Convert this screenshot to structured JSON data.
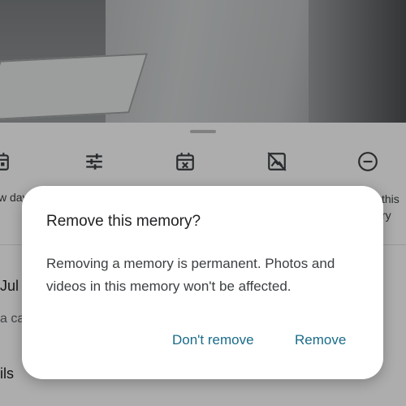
{
  "bottom_sheet": {
    "actions": [
      {
        "icon": "calendar-icon",
        "label": "w day"
      },
      {
        "icon": "tune-icon",
        "label": ""
      },
      {
        "icon": "calendar-remove-icon",
        "label": ""
      },
      {
        "icon": "hide-photo-icon",
        "label": ""
      },
      {
        "icon": "remove-circle-icon",
        "label": "this\nry"
      }
    ],
    "rows": [
      "Jul",
      "a ca",
      "ils"
    ]
  },
  "dialog": {
    "title": "Remove this memory?",
    "body": "Removing a memory is permanent. Photos and videos in this memory won't be affected.",
    "cancel_label": "Don't remove",
    "confirm_label": "Remove"
  },
  "colors": {
    "accent": "#1a6b8a",
    "scrim": "rgba(0,0,0,0.32)"
  }
}
